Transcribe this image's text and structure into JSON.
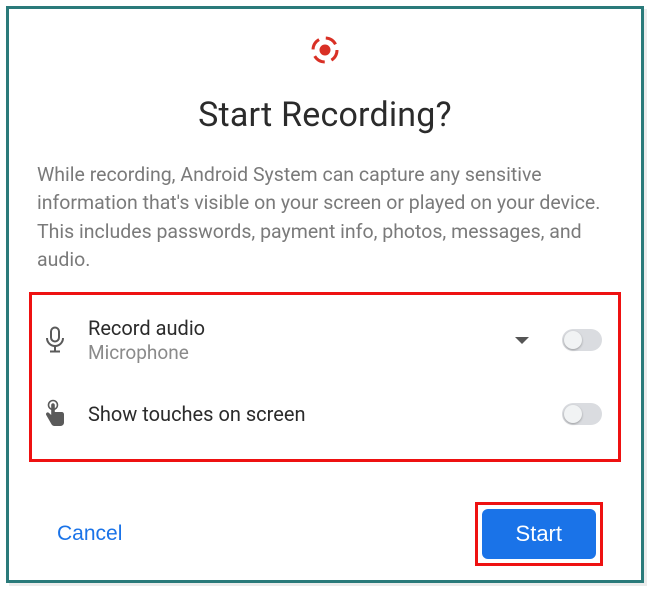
{
  "dialog": {
    "title": "Start Recording?",
    "description": "While recording, Android System can capture any sensitive information that's visible on your screen or played on your device. This includes passwords, payment info, photos, messages, and audio."
  },
  "options": {
    "record_audio": {
      "label": "Record audio",
      "subtitle": "Microphone",
      "enabled": false
    },
    "show_touches": {
      "label": "Show touches on screen",
      "enabled": false
    }
  },
  "actions": {
    "cancel_label": "Cancel",
    "start_label": "Start"
  },
  "colors": {
    "accent": "#1a73e8",
    "highlight": "#e11",
    "frame": "#2a7a7a",
    "record_icon": "#d93025"
  }
}
